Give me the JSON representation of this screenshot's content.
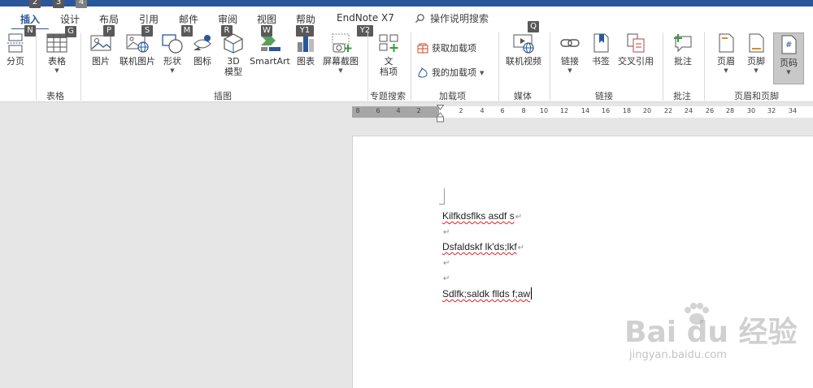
{
  "tabs": [
    {
      "label": "插入",
      "active": true
    },
    {
      "label": "设计"
    },
    {
      "label": "布局"
    },
    {
      "label": "引用"
    },
    {
      "label": "邮件"
    },
    {
      "label": "审阅"
    },
    {
      "label": "视图"
    },
    {
      "label": "帮助"
    },
    {
      "label": "EndNote X7"
    }
  ],
  "tab_keytips": [
    "2",
    "3",
    "4"
  ],
  "search": {
    "label": "操作说明搜索"
  },
  "keytips": {
    "page_break": "N",
    "table": "G",
    "picture": "P",
    "online_picture": "S",
    "shapes": "M",
    "icons": "R",
    "smartart": "W",
    "chart": "Y1",
    "screenshot": "Y2",
    "online_video": "Q"
  },
  "ribbon": {
    "page_break": "分页",
    "table": "表格",
    "picture": "图片",
    "online_picture": "联机图片",
    "shapes": "形状",
    "icons": "图标",
    "model3d_line1": "3D",
    "model3d_line2": "模型",
    "smartart": "SmartArt",
    "chart": "图表",
    "screenshot": "屏幕截图",
    "doc_line1": "文",
    "doc_line2": "档项",
    "get_addins": "获取加载项",
    "my_addins": "我的加载项",
    "online_video": "联机视频",
    "link": "链接",
    "bookmark": "书签",
    "cross_ref": "交叉引用",
    "comment": "批注",
    "header": "页眉",
    "footer": "页脚",
    "page_number": "页码"
  },
  "groups": {
    "tables": "表格",
    "illustrations": "插图",
    "topic_search": "专题搜索",
    "addins": "加载项",
    "media": "媒体",
    "links": "链接",
    "comments": "批注",
    "header_footer": "页眉和页脚"
  },
  "ruler": {
    "left_numbers": [
      "8",
      "6",
      "4",
      "2"
    ],
    "right_numbers": [
      "2",
      "4",
      "6",
      "8",
      "10",
      "12",
      "14",
      "16",
      "18",
      "20",
      "22",
      "24",
      "26",
      "28",
      "30",
      "32",
      "34"
    ]
  },
  "document": {
    "line1": "Kilfkdsflks asdf s",
    "line2": "Dsfaldskf lk'ds;lkf",
    "line3": "Sdlfk;saldk fllds f;aw",
    "paragraph_mark": "↵"
  },
  "watermark": {
    "main": "Bai du 经验",
    "sub": "jingyan.baidu.com"
  },
  "colors": {
    "accent": "#2b579a",
    "spellcheck": "#e02020"
  }
}
